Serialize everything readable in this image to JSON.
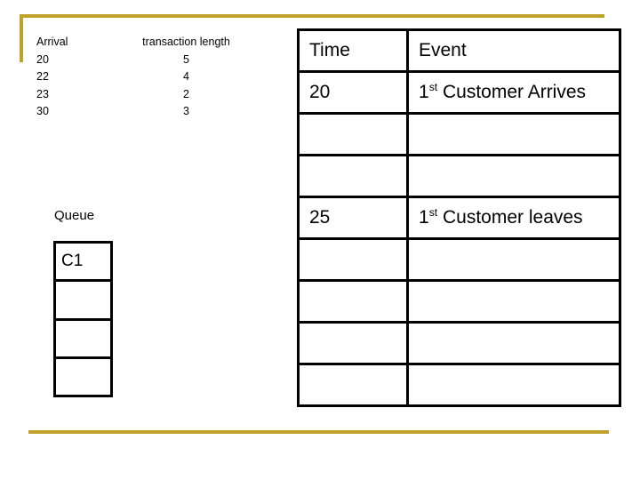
{
  "decor": {
    "accent_color": "#BFA22B",
    "top_rule": "top-gold-rule",
    "bottom_rule": "bottom-gold-rule"
  },
  "arrival_list": {
    "headers": {
      "arrival": "Arrival",
      "transaction_length": "transaction length"
    },
    "rows": [
      {
        "arrival": "20",
        "length": "5"
      },
      {
        "arrival": "22",
        "length": "4"
      },
      {
        "arrival": "23",
        "length": "2"
      },
      {
        "arrival": "30",
        "length": "3"
      }
    ]
  },
  "queue": {
    "label": "Queue",
    "cells": [
      {
        "value": "C1"
      },
      {
        "value": ""
      },
      {
        "value": ""
      },
      {
        "value": ""
      }
    ]
  },
  "event_table": {
    "headers": {
      "time": "Time",
      "event": "Event"
    },
    "rows": [
      {
        "time": "20",
        "event_prefix": "1",
        "event_sup": "st",
        "event_rest": " Customer Arrives"
      },
      {
        "time": "",
        "event_prefix": "",
        "event_sup": "",
        "event_rest": ""
      },
      {
        "time": "",
        "event_prefix": "",
        "event_sup": "",
        "event_rest": ""
      },
      {
        "time": "25",
        "event_prefix": "1",
        "event_sup": "st",
        "event_rest": " Customer leaves"
      },
      {
        "time": "",
        "event_prefix": "",
        "event_sup": "",
        "event_rest": ""
      },
      {
        "time": "",
        "event_prefix": "",
        "event_sup": "",
        "event_rest": ""
      },
      {
        "time": "",
        "event_prefix": "",
        "event_sup": "",
        "event_rest": ""
      },
      {
        "time": "",
        "event_prefix": "",
        "event_sup": "",
        "event_rest": ""
      }
    ]
  }
}
